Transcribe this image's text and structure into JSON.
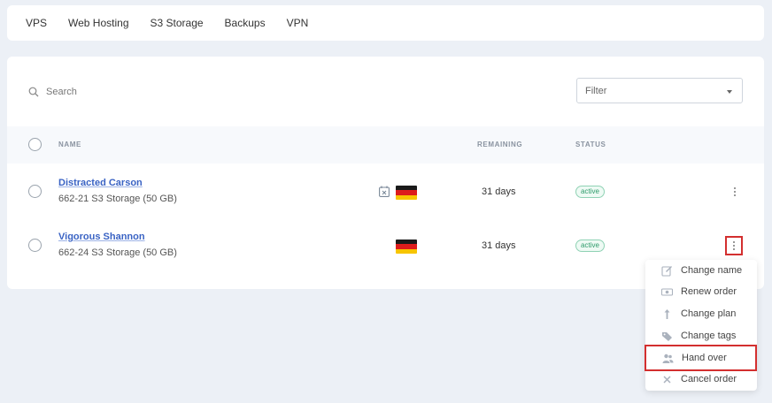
{
  "nav": {
    "items": [
      "VPS",
      "Web Hosting",
      "S3 Storage",
      "Backups",
      "VPN"
    ]
  },
  "toolbar": {
    "search_placeholder": "Search",
    "filter_placeholder": "Filter"
  },
  "table": {
    "headers": {
      "name": "NAME",
      "remaining": "REMAINING",
      "status": "STATUS"
    },
    "rows": [
      {
        "name": "Distracted Carson",
        "subtitle": "662-21  S3 Storage (50 GB)",
        "remaining": "31 days",
        "status": "active",
        "has_calendar_icon": true,
        "flag": "germany"
      },
      {
        "name": "Vigorous Shannon",
        "subtitle": "662-24  S3 Storage (50 GB)",
        "remaining": "31 days",
        "status": "active",
        "has_calendar_icon": false,
        "flag": "germany"
      }
    ]
  },
  "menu": {
    "items": [
      {
        "label": "Change name",
        "icon": "edit-icon"
      },
      {
        "label": "Renew order",
        "icon": "money-icon"
      },
      {
        "label": "Change plan",
        "icon": "arrow-up-icon"
      },
      {
        "label": "Change tags",
        "icon": "tag-icon"
      },
      {
        "label": "Hand over",
        "icon": "users-icon"
      },
      {
        "label": "Cancel order",
        "icon": "close-icon"
      }
    ],
    "highlighted": "Hand over"
  },
  "colors": {
    "link": "#3a63c4",
    "active_badge": "#2d9b6a",
    "highlight_border": "#d32f2f",
    "background": "#ecf0f6"
  }
}
